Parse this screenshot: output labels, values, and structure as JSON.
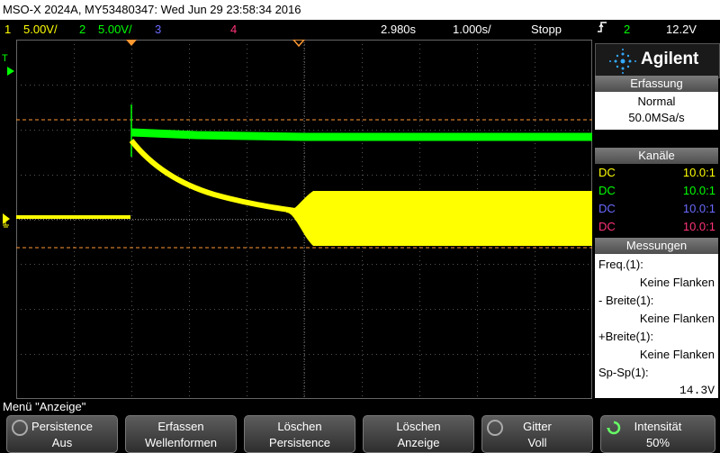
{
  "title": "MSO-X 2024A, MY53480347: Wed Jun 29 23:58:34 2016",
  "status": {
    "ch1_num": "1",
    "ch1_scale": "5.00V/",
    "ch2_num": "2",
    "ch2_scale": "5.00V/",
    "ch3_num": "3",
    "ch4_num": "4",
    "timebase_pos": "2.980s",
    "timebase_scale": "1.000s/",
    "run_state": "Stopp",
    "trigger_icon": "trigger-edge-icon",
    "trigger_source": "2",
    "trigger_level": "12.2V"
  },
  "colors": {
    "ch1": "#ffff00",
    "ch2": "#00ff00",
    "ch3": "#6a6aff",
    "ch4": "#ff3377",
    "accent": "#ff9933",
    "trigger_marker": "#00ff00"
  },
  "panel": {
    "brand": "Agilent",
    "acq_header": "Erfassung",
    "acq_mode": "Normal",
    "acq_rate": "50.0MSa/s",
    "channels_header": "Kanäle",
    "channels": [
      {
        "coupling": "DC",
        "probe": "10.0:1"
      },
      {
        "coupling": "DC",
        "probe": "10.0:1"
      },
      {
        "coupling": "DC",
        "probe": "10.0:1"
      },
      {
        "coupling": "DC",
        "probe": "10.0:1"
      }
    ],
    "meas_header": "Messungen",
    "measurements": [
      {
        "name": "Freq.(1):",
        "value": "Keine Flanken"
      },
      {
        "name": "- Breite(1):",
        "value": "Keine Flanken"
      },
      {
        "name": "+Breite(1):",
        "value": "Keine Flanken"
      },
      {
        "name": "Sp-Sp(1):",
        "value": "14.3V"
      }
    ]
  },
  "menu_label": "Menü \"Anzeige\"",
  "softkeys": [
    {
      "line1": "Persistence",
      "line2": "Aus"
    },
    {
      "line1": "Erfassen",
      "line2": "Wellenformen"
    },
    {
      "line1": "Löschen",
      "line2": "Persistence"
    },
    {
      "line1": "Löschen",
      "line2": "Anzeige"
    },
    {
      "line1": "Gitter",
      "line2": "Voll"
    },
    {
      "line1": "Intensität",
      "line2": "50%"
    }
  ],
  "marker_T": "T"
}
